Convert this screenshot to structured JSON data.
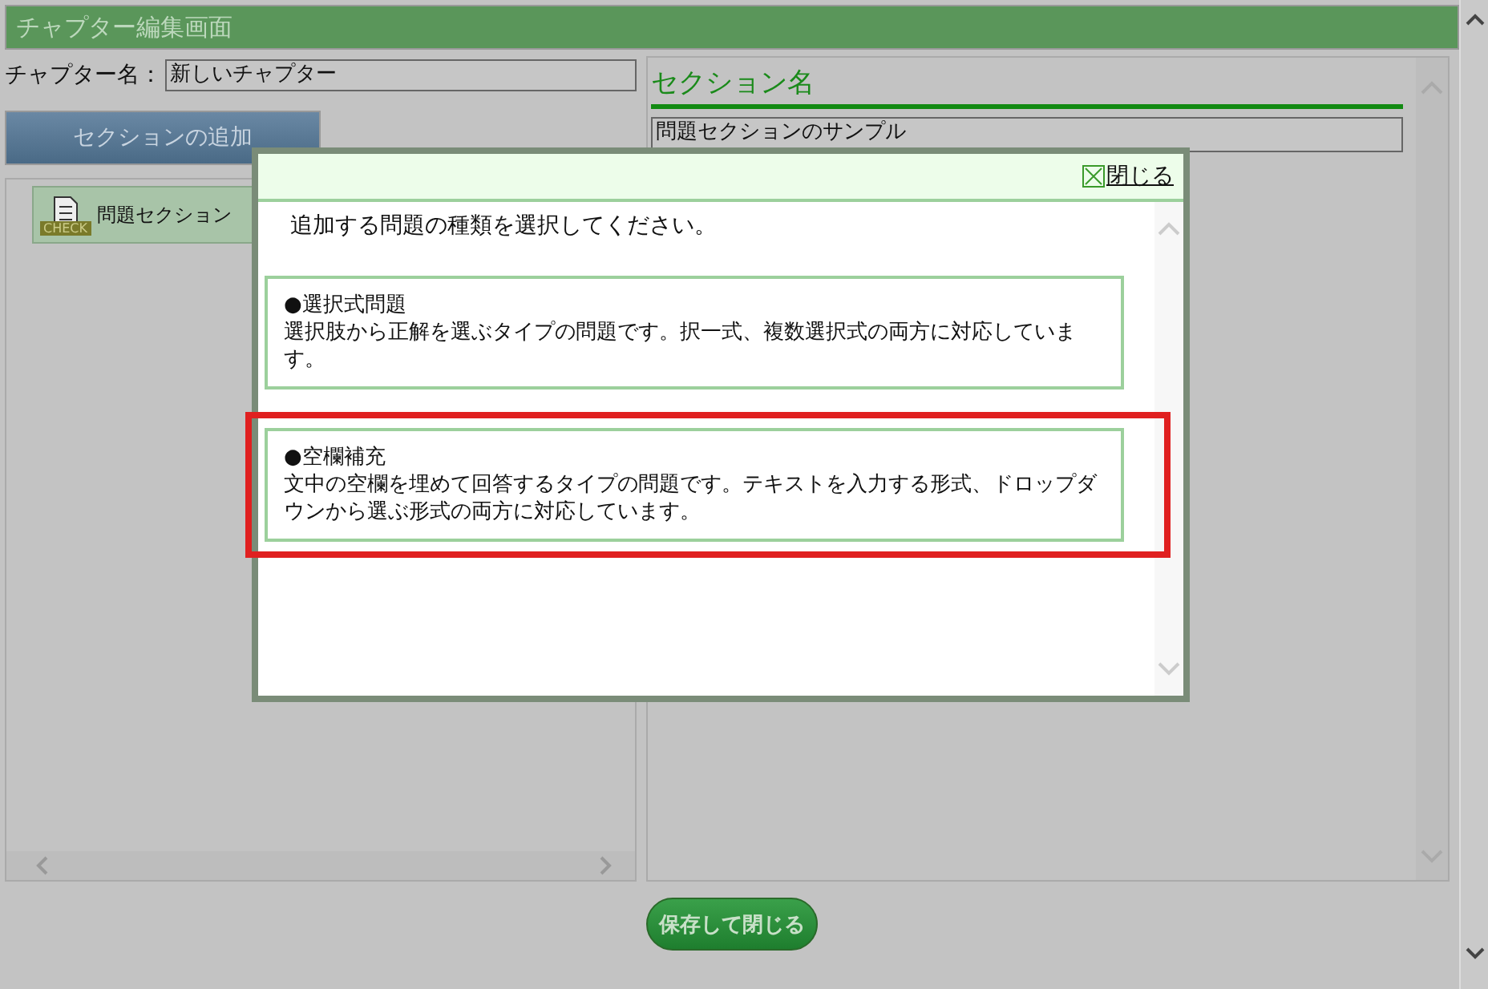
{
  "window": {
    "title": "チャプター編集画面"
  },
  "chapter": {
    "label": "チャプター名：",
    "value": "新しいチャプター"
  },
  "add_section_button": "セクションの追加",
  "sections": [
    {
      "label": "問題セクション",
      "badge": "CHECK"
    }
  ],
  "section_panel": {
    "heading": "セクション名",
    "value": "問題セクションのサンプル"
  },
  "save_button": "保存して閉じる",
  "dialog": {
    "close": "閉じる",
    "prompt": "追加する問題の種類を選択してください。",
    "options": [
      {
        "title": "●選択式問題",
        "description": "選択肢から正解を選ぶタイプの問題です。択一式、複数選択式の両方に対応しています。",
        "selected": false
      },
      {
        "title": "●空欄補充",
        "description": "文中の空欄を埋めて回答するタイプの問題です。テキストを入力する形式、ドロップダウンから選ぶ形式の両方に対応しています。",
        "selected": true
      }
    ]
  }
}
